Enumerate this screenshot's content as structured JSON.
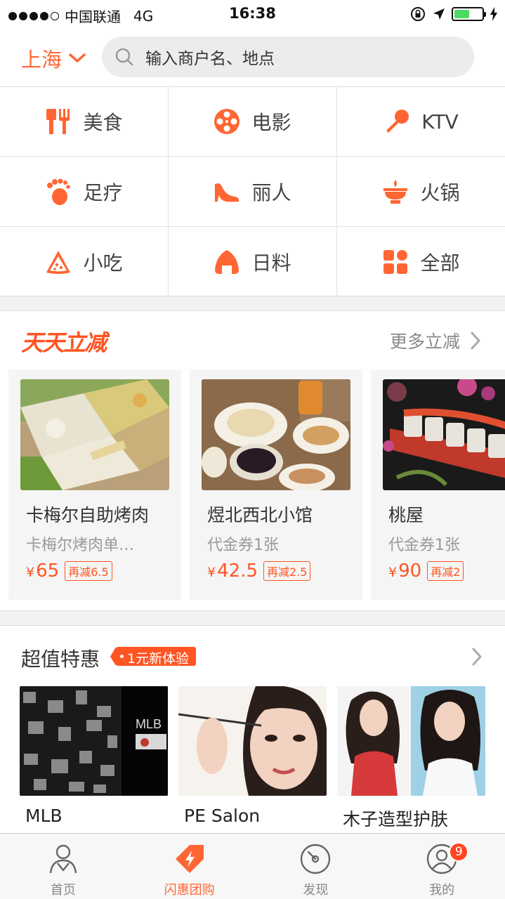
{
  "status_bar": {
    "carrier": "中国联通",
    "network": "4G",
    "time": "16:38",
    "battery_level": 0.55,
    "signal_bars": 4
  },
  "header": {
    "city": "上海",
    "search_placeholder": "输入商户名、地点"
  },
  "categories": [
    {
      "label": "美食",
      "icon": "utensils-icon"
    },
    {
      "label": "电影",
      "icon": "film-reel-icon"
    },
    {
      "label": "KTV",
      "icon": "microphone-icon"
    },
    {
      "label": "足疗",
      "icon": "footprint-icon"
    },
    {
      "label": "丽人",
      "icon": "high-heel-icon"
    },
    {
      "label": "火锅",
      "icon": "hotpot-icon"
    },
    {
      "label": "小吃",
      "icon": "pizza-slice-icon"
    },
    {
      "label": "日料",
      "icon": "onigiri-icon"
    },
    {
      "label": "全部",
      "icon": "grid-icon"
    }
  ],
  "daily_deals": {
    "logo_text": "天天立减",
    "more_label": "更多立减",
    "items": [
      {
        "title": "卡梅尔自助烤肉",
        "subtitle": "卡梅尔烤肉单…",
        "currency": "¥",
        "price": "65",
        "discount": "再减6.5"
      },
      {
        "title": "煜北西北小馆",
        "subtitle": "代金券1张",
        "currency": "¥",
        "price": "42.5",
        "discount": "再减2.5"
      },
      {
        "title": "桃屋",
        "subtitle": "代金券1张",
        "currency": "¥",
        "price": "90",
        "discount": "再减2"
      }
    ]
  },
  "super_deals": {
    "title": "超值特惠",
    "badge": "1元新体验",
    "items": [
      {
        "name": "MLB"
      },
      {
        "name": "PE Salon"
      },
      {
        "name": "木子造型护肤"
      }
    ]
  },
  "tabbar": {
    "tabs": [
      {
        "label": "首页",
        "icon": "home-person-icon",
        "active": false
      },
      {
        "label": "闪惠团购",
        "icon": "lightning-tag-icon",
        "active": true
      },
      {
        "label": "发现",
        "icon": "compass-icon",
        "active": false
      },
      {
        "label": "我的",
        "icon": "profile-icon",
        "active": false,
        "badge": "9"
      }
    ]
  },
  "colors": {
    "accent": "#ff6633",
    "price": "#ff5522"
  }
}
